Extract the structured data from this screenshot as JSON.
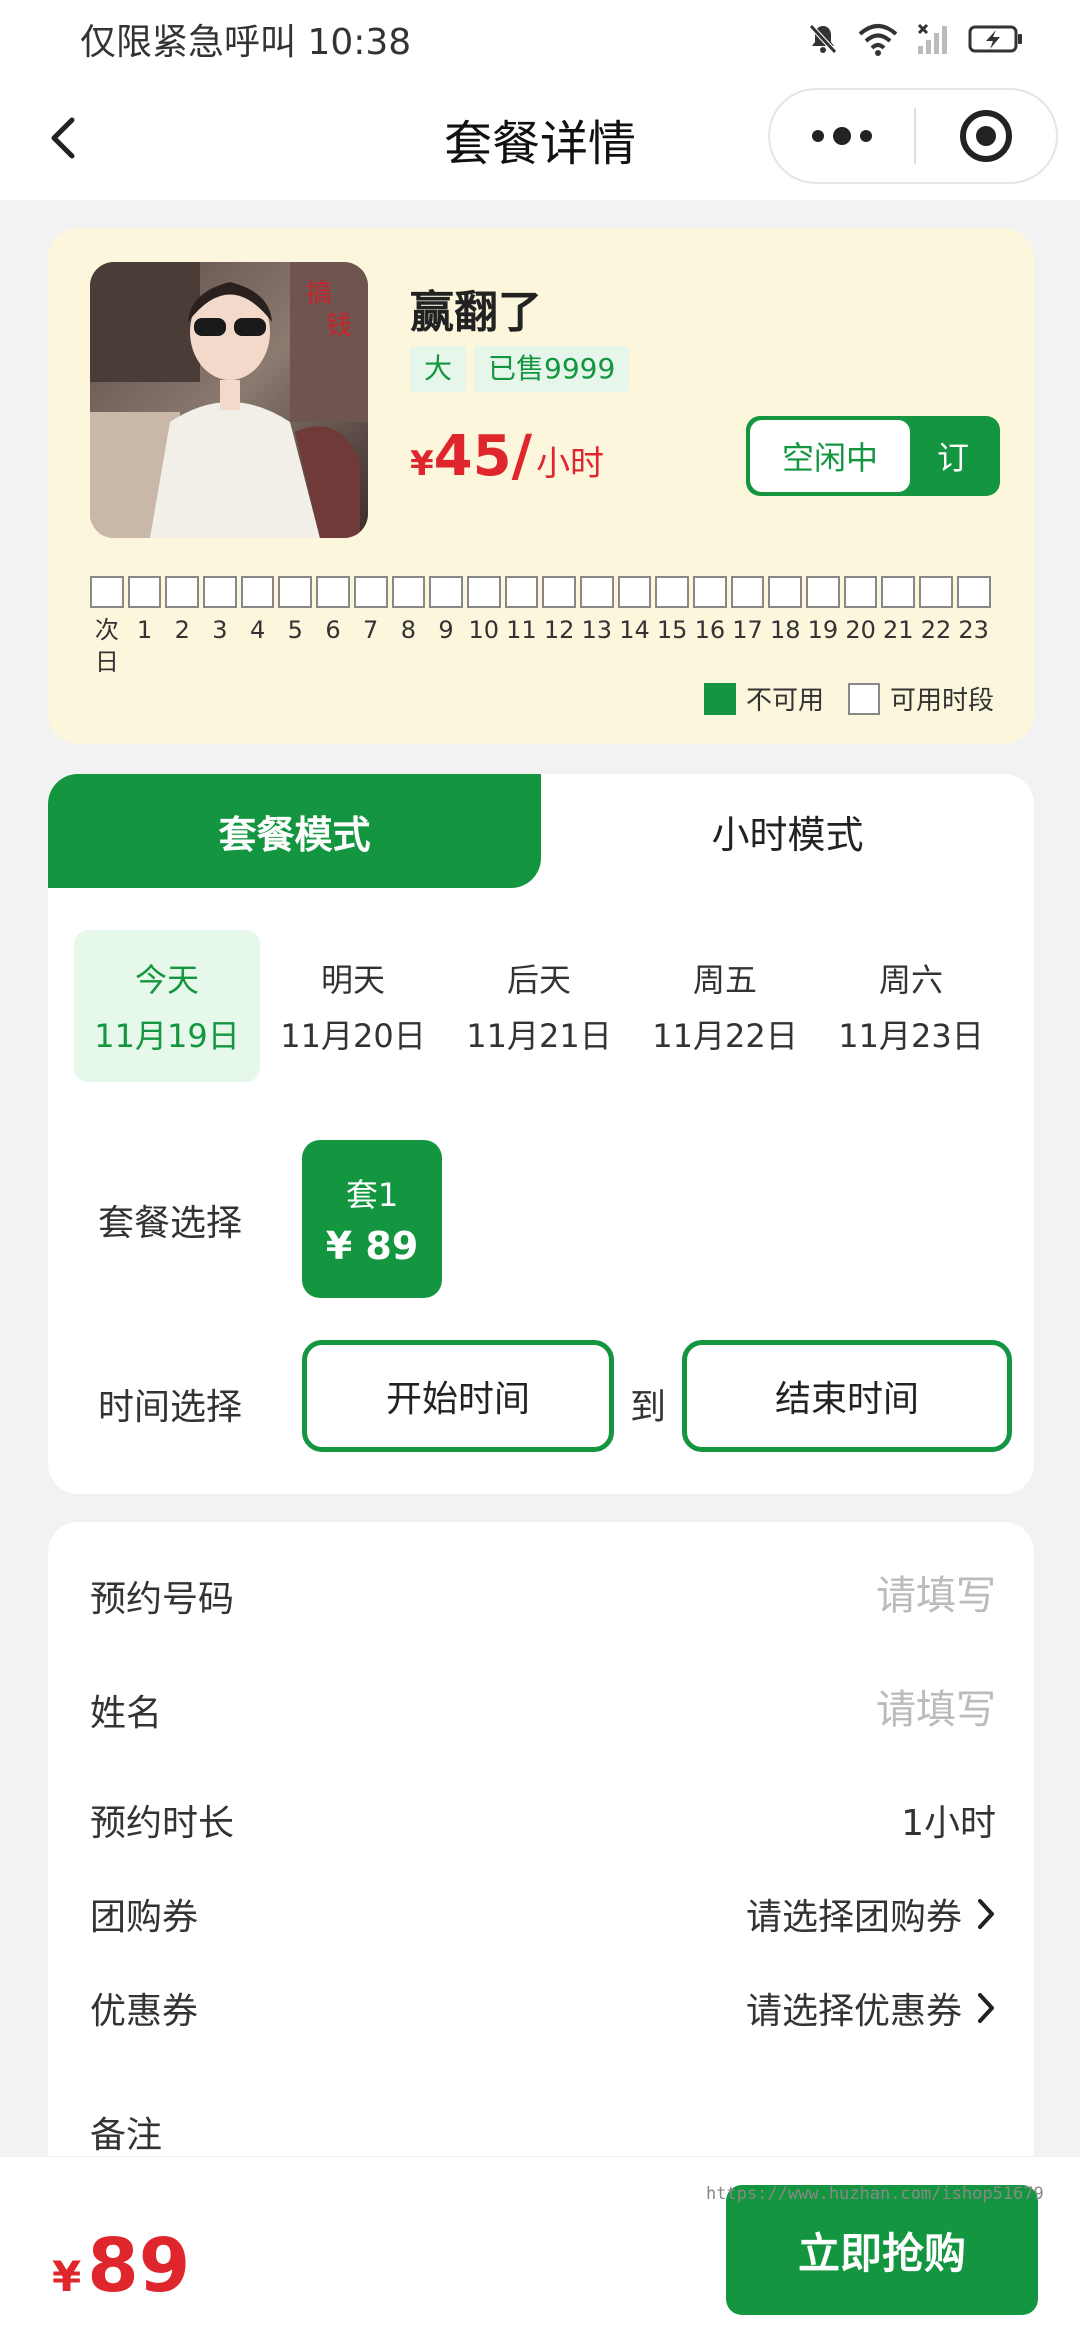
{
  "status_bar": {
    "left_text": "仅限紧急呼叫 10:38"
  },
  "nav": {
    "title": "套餐详情"
  },
  "room": {
    "name": "赢翻了",
    "tags": [
      "大",
      "已售9999"
    ],
    "price": {
      "currency": "¥",
      "value": "45/",
      "unit": "小时"
    },
    "status": {
      "left": "空闲中",
      "right": "订"
    },
    "hours": [
      "次日",
      "1",
      "2",
      "3",
      "4",
      "5",
      "6",
      "7",
      "8",
      "9",
      "10",
      "11",
      "12",
      "13",
      "14",
      "15",
      "16",
      "17",
      "18",
      "19",
      "20",
      "21",
      "22",
      "23"
    ],
    "legend": {
      "used": "不可用",
      "free": "可用时段"
    },
    "colors": {
      "used": "#13963f",
      "card_bg": "#fcf6dd"
    }
  },
  "booking": {
    "tabs": [
      {
        "label": "套餐模式",
        "active": true
      },
      {
        "label": "小时模式",
        "active": false
      }
    ],
    "dates": [
      {
        "day": "今天",
        "date": "11月19日",
        "active": true
      },
      {
        "day": "明天",
        "date": "11月20日",
        "active": false
      },
      {
        "day": "后天",
        "date": "11月21日",
        "active": false
      },
      {
        "day": "周五",
        "date": "11月22日",
        "active": false
      },
      {
        "day": "周六",
        "date": "11月23日",
        "active": false
      }
    ],
    "package_label": "套餐选择",
    "package": {
      "name": "套1",
      "price": "¥ 89"
    },
    "time_label": "时间选择",
    "start_time": "开始时间",
    "to": "到",
    "end_time": "结束时间"
  },
  "form": {
    "phone": {
      "label": "预约号码",
      "placeholder": "请填写"
    },
    "name": {
      "label": "姓名",
      "placeholder": "请填写"
    },
    "duration": {
      "label": "预约时长",
      "value": "1小时"
    },
    "group_coupon": {
      "label": "团购券",
      "value": "请选择团购券"
    },
    "coupon": {
      "label": "优惠券",
      "value": "请选择优惠券"
    },
    "note": {
      "label": "备注"
    }
  },
  "bottom": {
    "currency": "¥",
    "total": "89",
    "buy_label": "立即抢购",
    "watermark": "https://www.huzhan.com/ishop51679"
  },
  "theme": {
    "accent": "#13963f",
    "price_red": "#e0262d"
  }
}
